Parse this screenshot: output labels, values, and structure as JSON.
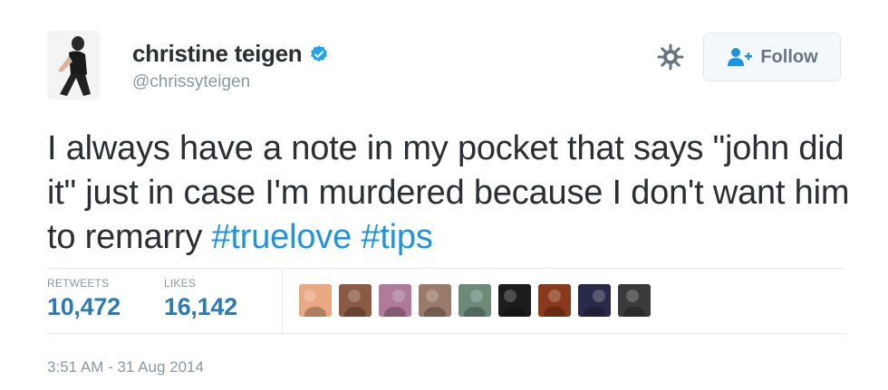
{
  "user": {
    "display_name": "christine teigen",
    "handle": "@chrissyteigen",
    "verified": true
  },
  "follow_button": {
    "label": "Follow"
  },
  "tweet": {
    "text_parts": [
      "I always have a note in my pocket that says \"john did it\" just in case I'm murdered because I don't want him to remarry ",
      "#truelove",
      " ",
      "#tips"
    ]
  },
  "stats": {
    "retweets_label": "RETWEETS",
    "retweets_value": "10,472",
    "likes_label": "LIKES",
    "likes_value": "16,142"
  },
  "likers": [
    {
      "id": "liker-1",
      "color": "#e8a882"
    },
    {
      "id": "liker-2",
      "color": "#8a5a44"
    },
    {
      "id": "liker-3",
      "color": "#b07a9a"
    },
    {
      "id": "liker-4",
      "color": "#9a7b6a"
    },
    {
      "id": "liker-5",
      "color": "#6c8a7a"
    },
    {
      "id": "liker-6",
      "color": "#1c1c1c"
    },
    {
      "id": "liker-7",
      "color": "#8a3a1c"
    },
    {
      "id": "liker-8",
      "color": "#2a2a4a"
    },
    {
      "id": "liker-9",
      "color": "#3a3a3a"
    }
  ],
  "timestamp": "3:51 AM - 31 Aug 2014",
  "colors": {
    "link": "#1b95e0",
    "stat_value": "#2b7bb9",
    "muted": "#8899a6",
    "verified": "#1da1f2"
  }
}
